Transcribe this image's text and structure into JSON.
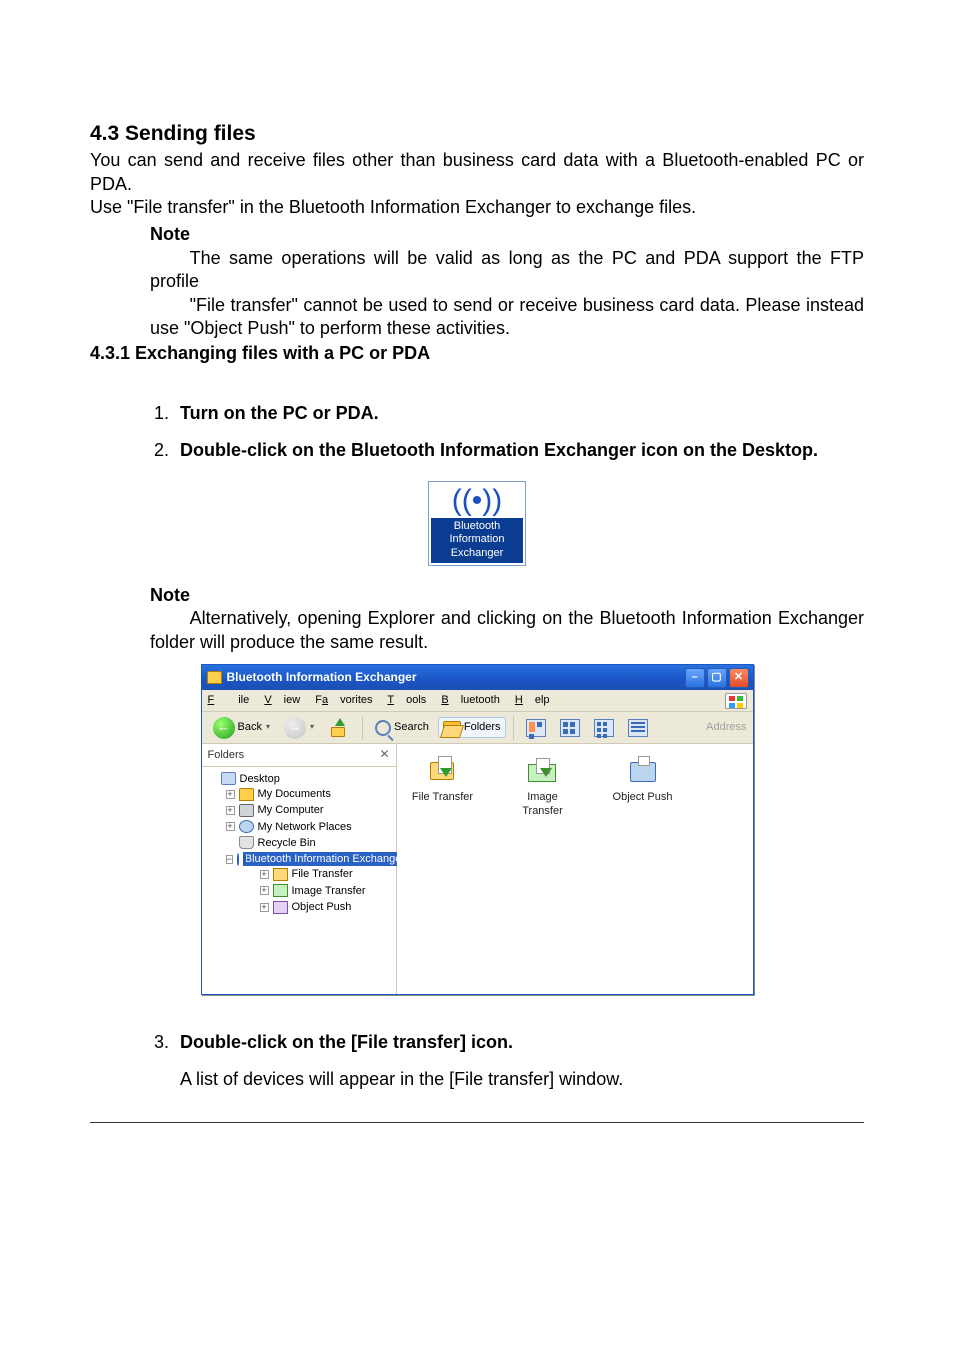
{
  "section": {
    "heading": "4.3  Sending files",
    "intro1": "You can send and receive files other than business card data with a Bluetooth-enabled PC or PDA.",
    "intro2": "Use \"File transfer\" in the Bluetooth Information Exchanger to exchange files."
  },
  "note1": {
    "label": "Note",
    "p1": "The same operations will be valid as long as the PC and PDA support the FTP profile",
    "p2": "\"File transfer\" cannot be used to send or receive business card data. Please instead use \"Object Push\" to perform these activities."
  },
  "subsection": "4.3.1  Exchanging files with a PC or PDA",
  "steps": {
    "s1": "Turn on the PC or PDA.",
    "s2": "Double-click on the Bluetooth Information Exchanger icon on the Desktop.",
    "s3": "Double-click on the [File transfer] icon.",
    "s3b": "A list of devices will appear in the [File transfer] window."
  },
  "desktopIcon": {
    "line1": "Bluetooth",
    "line2": "Information",
    "line3": "Exchanger"
  },
  "note2": {
    "label": "Note",
    "p1": "Alternatively, opening Explorer and clicking on the Bluetooth Information Exchanger folder will produce the same result."
  },
  "explorer": {
    "title": "Bluetooth Information Exchanger",
    "menu": {
      "file": "File",
      "view": "View",
      "favorites": "Favorites",
      "tools": "Tools",
      "bluetooth": "Bluetooth",
      "help": "Help"
    },
    "toolbar": {
      "back": "Back",
      "search": "Search",
      "folders": "Folders",
      "address": "Address"
    },
    "treeHeader": "Folders",
    "tree": {
      "desktop": "Desktop",
      "mydocs": "My Documents",
      "mycomp": "My Computer",
      "mynet": "My Network Places",
      "recycle": "Recycle Bin",
      "bie": "Bluetooth Information Exchanger",
      "ft": "File Transfer",
      "it": "Image Transfer",
      "op": "Object Push"
    },
    "icons": {
      "fileTransfer": "File Transfer",
      "imageTransfer": "Image Transfer",
      "objectPush": "Object Push"
    }
  }
}
